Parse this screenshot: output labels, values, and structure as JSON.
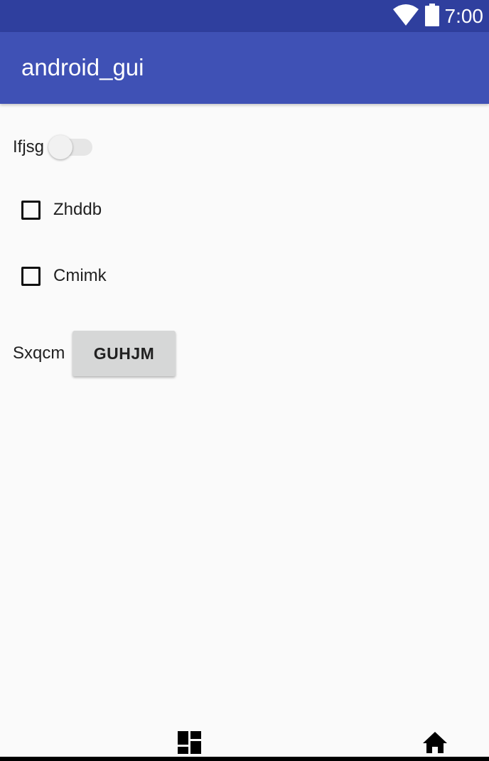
{
  "status_bar": {
    "time": "7:00",
    "icons": [
      "wifi-icon",
      "battery-icon"
    ],
    "background": "#2f3f9e"
  },
  "app_bar": {
    "title": "android_gui",
    "background": "#3f51b5"
  },
  "form": {
    "switch": {
      "label": "Ifjsg",
      "checked": false
    },
    "checkboxes": [
      {
        "label": "Zhddb",
        "checked": false
      },
      {
        "label": "Cmimk",
        "checked": false
      }
    ],
    "button_row": {
      "label": "Sxqcm",
      "button_text": "GUHJM"
    }
  },
  "nav_bar": {
    "icons": [
      "dashboard-icon",
      "home-icon"
    ]
  }
}
